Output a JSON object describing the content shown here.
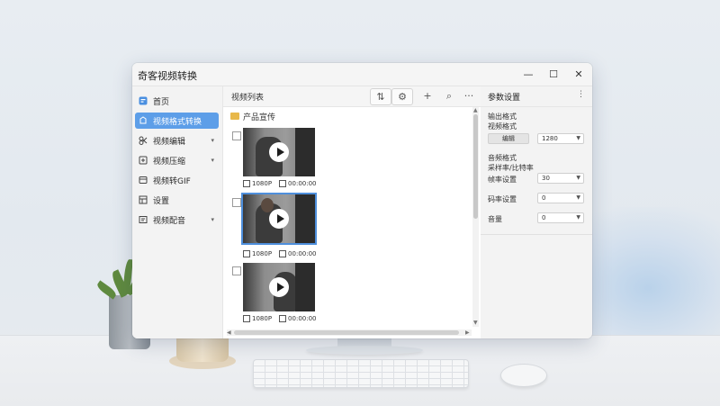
{
  "window": {
    "title": "奇客视频转换",
    "minimize": "—",
    "maximize": "☐",
    "close": "✕"
  },
  "sidebar": {
    "items": [
      {
        "label": "首页",
        "icon": "home-icon",
        "active": false,
        "has_chevron": false
      },
      {
        "label": "视频格式转换",
        "icon": "convert-icon",
        "active": true,
        "has_chevron": false
      },
      {
        "label": "视频编辑",
        "icon": "edit-icon",
        "active": false,
        "has_chevron": true
      },
      {
        "label": "视频压缩",
        "icon": "compress-icon",
        "active": false,
        "has_chevron": true
      },
      {
        "label": "视频转GIF",
        "icon": "gif-icon",
        "active": false,
        "has_chevron": false
      },
      {
        "label": "设置",
        "icon": "settings-icon",
        "active": false,
        "has_chevron": false
      },
      {
        "label": "视频配音",
        "icon": "dub-icon",
        "active": false,
        "has_chevron": true
      }
    ],
    "chevron": "▾"
  },
  "main": {
    "title": "视频列表",
    "toolbar": {
      "sort": "⇅",
      "link": "⚙",
      "add": "+",
      "search": "⌕",
      "more": "···"
    },
    "folder": "产品宣传",
    "videos": [
      {
        "resolution": "1080P",
        "duration": "00:00:00",
        "selected": false
      },
      {
        "resolution": "1080P",
        "duration": "00:00:00",
        "selected": true
      },
      {
        "resolution": "1080P",
        "duration": "00:00:00",
        "selected": false
      }
    ]
  },
  "params": {
    "title": "参数设置",
    "more": "⋮",
    "output_format_label": "输出格式",
    "video_format_label": "视频格式",
    "video_format_button": "编辑",
    "video_format_value": "1280",
    "audio_format_label": "音频格式",
    "audio_sub_label": "采样率/比特率",
    "rate_label": "帧率设置",
    "rate_value": "30",
    "bitrate_label": "码率设置",
    "bitrate_value": "0",
    "volume_label": "音量",
    "volume_value": "0"
  }
}
